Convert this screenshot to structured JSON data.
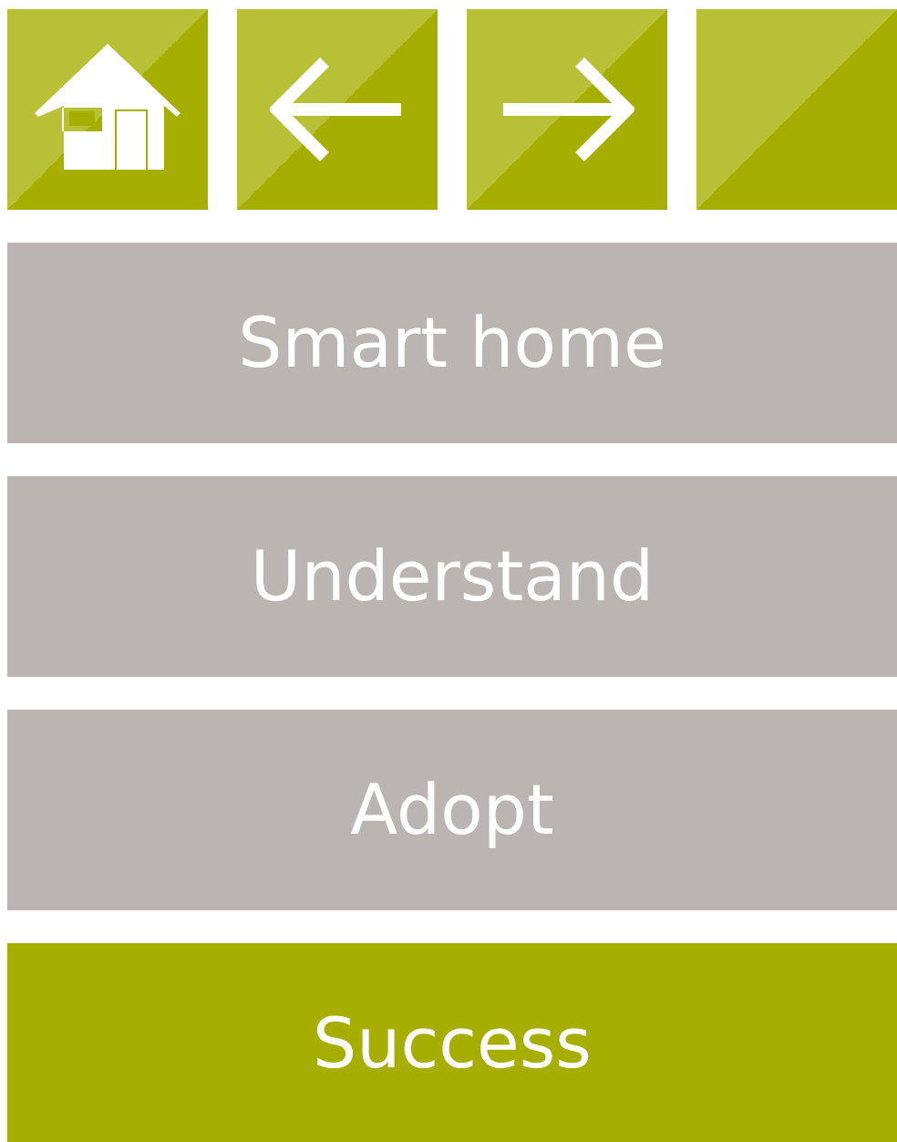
{
  "toolbar": [
    {
      "kind": "home"
    },
    {
      "kind": "back"
    },
    {
      "kind": "forward"
    },
    {
      "kind": "blank"
    }
  ],
  "menu": [
    {
      "label": "Smart home",
      "selected": false
    },
    {
      "label": "Understand",
      "selected": false
    },
    {
      "label": "Adopt",
      "selected": false
    },
    {
      "label": "Success",
      "selected": true
    }
  ]
}
